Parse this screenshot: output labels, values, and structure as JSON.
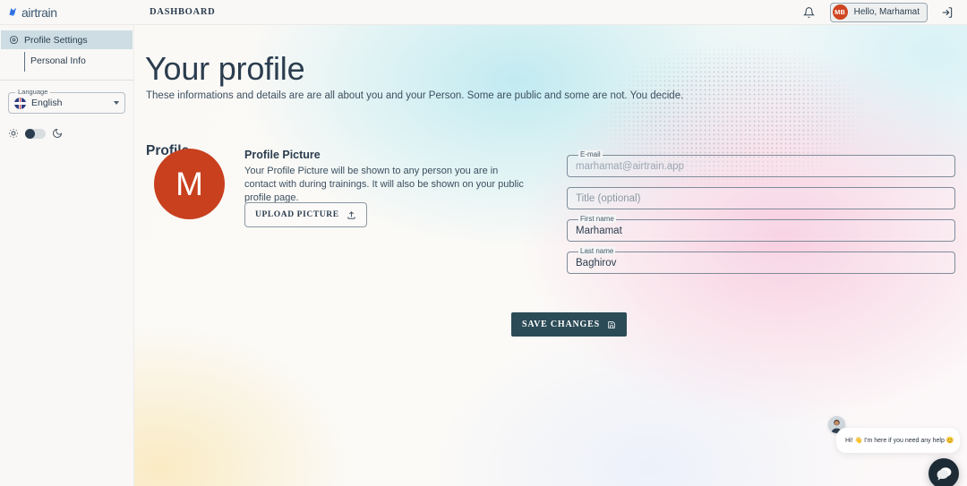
{
  "header": {
    "logo_text": "airtrain",
    "logo_icon": "airtrain-logo-mark",
    "dashboard_label": "DASHBOARD",
    "bell_icon": "bell-icon",
    "logout_icon": "logout-icon",
    "user": {
      "initials": "MB",
      "greeting": "Hello, Marhamat"
    }
  },
  "sidebar": {
    "items": [
      {
        "label": "Profile Settings",
        "icon": "target-icon",
        "active": true
      },
      {
        "label": "Personal Info",
        "active": false
      }
    ],
    "language": {
      "label": "Language",
      "value": "English",
      "flag_icon": "uk-flag-icon",
      "caret_icon": "chevron-down-icon"
    },
    "theme": {
      "light_icon": "sun-icon",
      "dark_icon": "moon-icon",
      "state": "light"
    }
  },
  "main": {
    "title": "Your profile",
    "subtitle": "These informations and details are are all about you and your Person. Some are public and some are not. You decide.",
    "section_title": "Profile",
    "avatar_initial": "M",
    "avatar_color": "#c8401e",
    "profile_picture": {
      "title": "Profile Picture",
      "description": "Your Profile Picture will be shown to any person you are in contact with during trainings. It will also be shown on your public profile page.",
      "upload_label": "UPLOAD PICTURE",
      "upload_icon": "upload-icon"
    },
    "fields": [
      {
        "label": "E-mail",
        "value": "marhamat@airtrain.app",
        "placeholder": "E-mail",
        "disabled": true,
        "floating": true
      },
      {
        "label": "",
        "value": "",
        "placeholder": "Title (optional)",
        "disabled": false,
        "floating": false
      },
      {
        "label": "First name",
        "value": "Marhamat",
        "placeholder": "First name",
        "disabled": false,
        "floating": true
      },
      {
        "label": "Last name",
        "value": "Baghirov",
        "placeholder": "Last name",
        "disabled": false,
        "floating": true
      }
    ],
    "save": {
      "label": "SAVE CHANGES",
      "icon": "save-icon",
      "color": "#2b4b56"
    }
  },
  "chat": {
    "message": "Hi! 👋 I'm here if you need any help 😊",
    "avatar_icon": "agent-avatar",
    "launcher_icon": "chat-bubbles-icon"
  }
}
